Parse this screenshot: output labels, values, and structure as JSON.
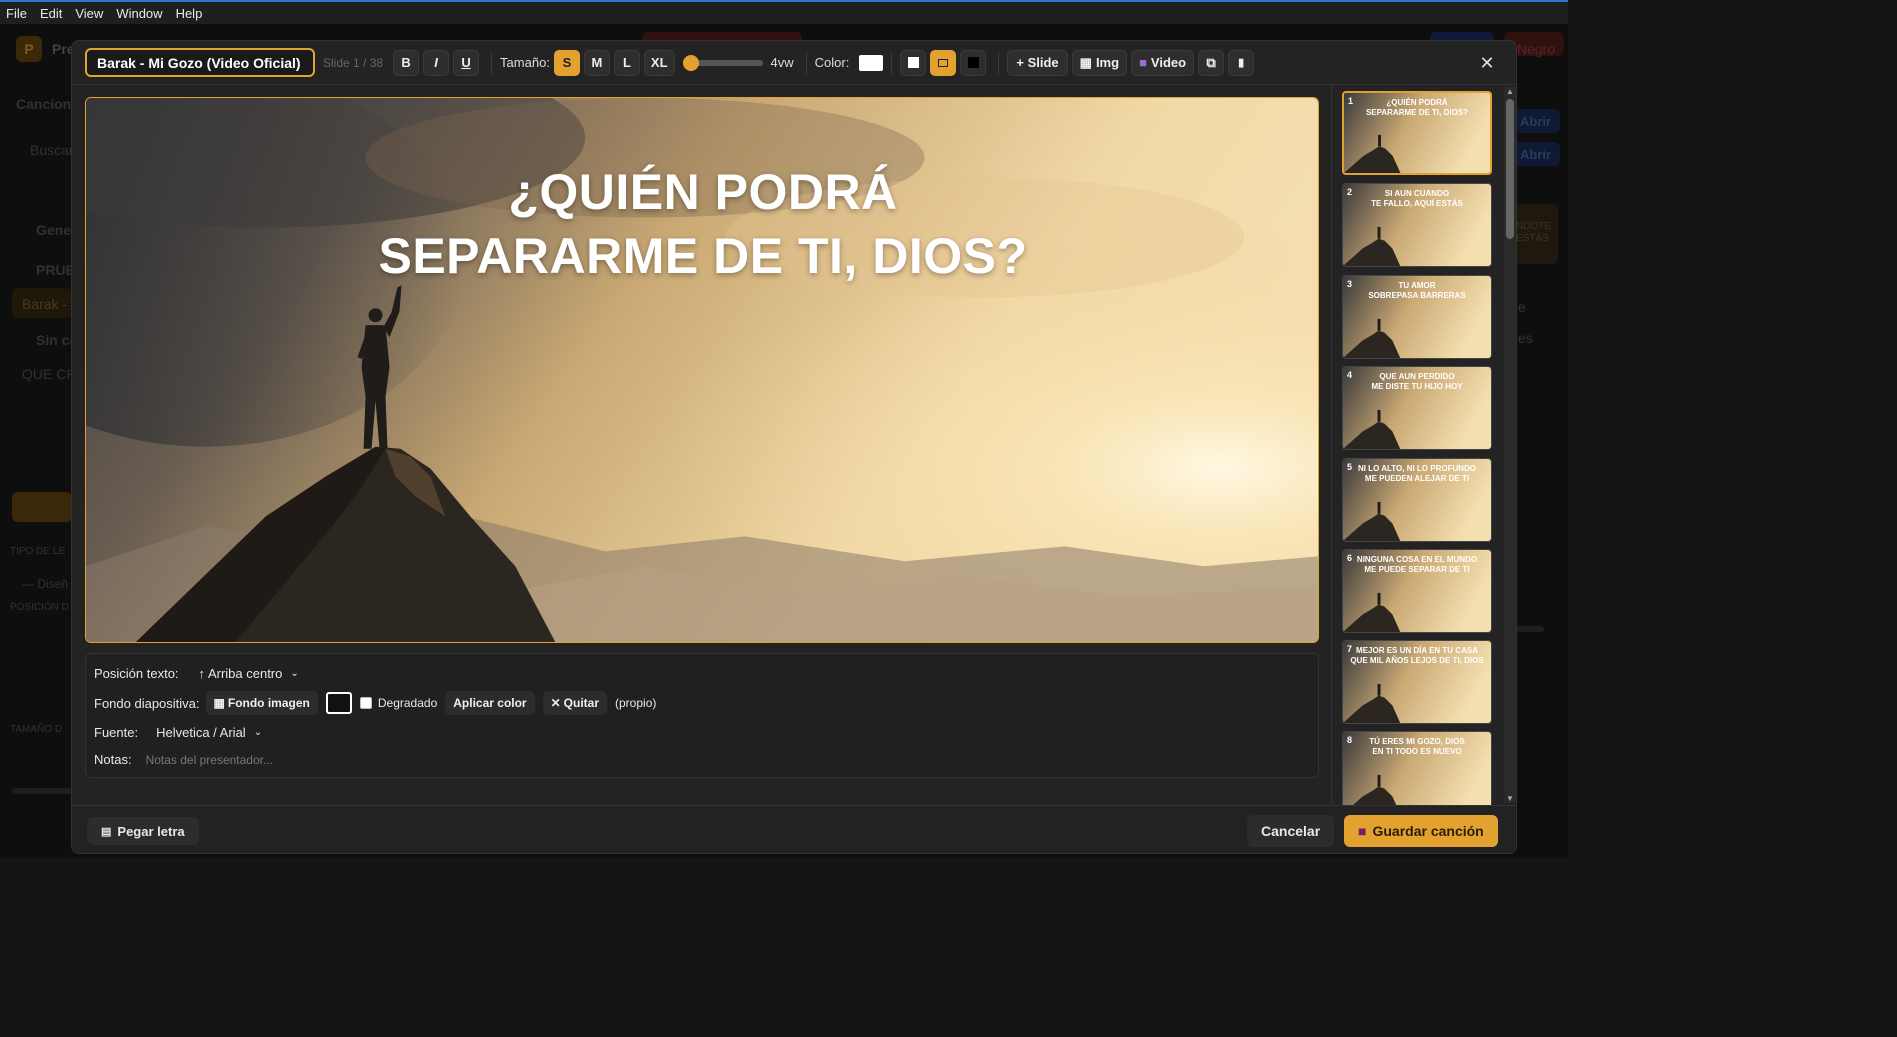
{
  "menubar": {
    "items": [
      "File",
      "Edit",
      "View",
      "Window",
      "Help"
    ]
  },
  "background_app": {
    "left_labels": [
      "Pre",
      "Cancione",
      "Buscar",
      "Gene",
      "PRUE",
      "Barak -",
      "Sin ca",
      "QUE CR",
      "TIPO DE LE",
      "— Diseñ",
      "POSICIÓN D",
      "TAMAÑO D"
    ],
    "right_labels": [
      "Negro",
      "Abrir",
      "Abrir",
      "NDOTE\nESTÁS",
      "e",
      "es"
    ]
  },
  "editor": {
    "title_value": "Barak - Mi Gozo (Video Oficial)",
    "slide_counter": "Slide 1 / 38",
    "format_buttons": {
      "bold": "B",
      "italic": "I",
      "underline": "U"
    },
    "size_label": "Tamaño:",
    "sizes": [
      "S",
      "M",
      "L",
      "XL"
    ],
    "active_size": "S",
    "font_scale_value": "4vw",
    "font_scale_fraction": 0.1,
    "color_label": "Color:",
    "text_color": "#ffffff",
    "actions": {
      "add_slide": "+ Slide",
      "add_img": "Img",
      "add_video": "Video"
    },
    "close_icon": "close-icon",
    "accent_color": "#e3a230"
  },
  "preview": {
    "text_line1": "¿QUIÉN PODRÁ",
    "text_line2": "SEPARARME DE TI, DIOS?"
  },
  "options": {
    "position_label": "Posición texto:",
    "position_value": "↑ Arriba centro",
    "background_label": "Fondo diapositiva:",
    "background_image_btn": "Fondo imagen",
    "gradient_label": "Degradado",
    "apply_color_btn": "Aplicar color",
    "remove_btn": "Quitar",
    "own_tag": "(propio)",
    "font_label": "Fuente:",
    "font_value": "Helvetica / Arial",
    "notes_label": "Notas:",
    "notes_placeholder": "Notas del presentador..."
  },
  "thumbnails": [
    {
      "num": "1",
      "text": "¿QUIÉN PODRÁ\nSEPARARME DE TI, DIOS?"
    },
    {
      "num": "2",
      "text": "SI AUN CUANDO\nTE FALLO, AQUÍ ESTÁS"
    },
    {
      "num": "3",
      "text": "TU AMOR\nSOBREPASA BARRERAS"
    },
    {
      "num": "4",
      "text": "QUE AUN PERDIDO\nME DISTE TU HIJO HOY"
    },
    {
      "num": "5",
      "text": "NI LO ALTO, NI LO PROFUNDO\nME PUEDEN ALEJAR DE TI"
    },
    {
      "num": "6",
      "text": "NINGUNA COSA EN EL MUNDO\nME PUEDE SEPARAR DE TI"
    },
    {
      "num": "7",
      "text": "MEJOR ES UN DÍA EN TU CASA\nQUE MIL AÑOS LEJOS DE TI, DIOS"
    },
    {
      "num": "8",
      "text": "TÚ ERES MI GOZO, DIOS\nEN TI TODO ES NUEVO"
    }
  ],
  "footer": {
    "paste_lyrics": "Pegar letra",
    "cancel": "Cancelar",
    "save": "Guardar canción"
  }
}
